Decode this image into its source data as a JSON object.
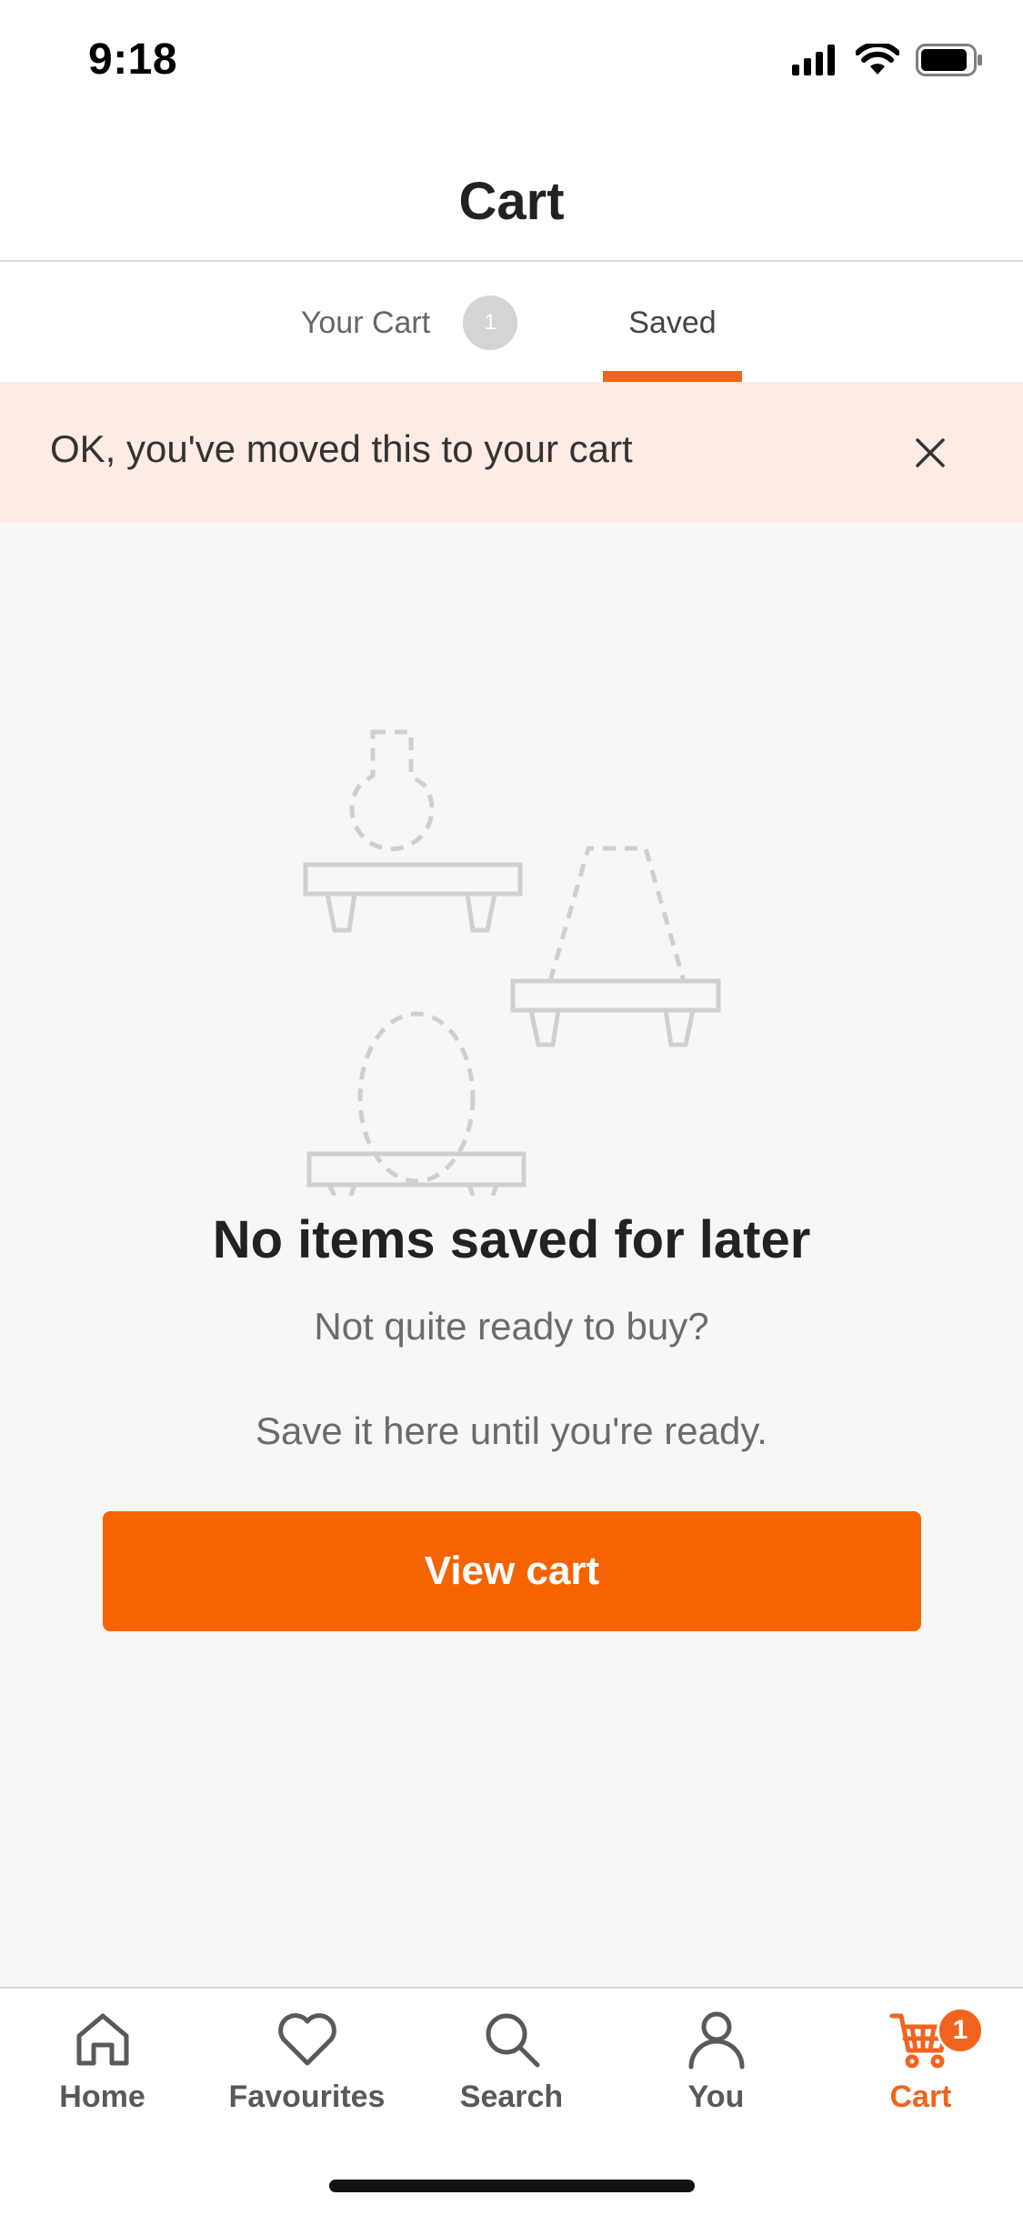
{
  "status_bar": {
    "time": "9:18"
  },
  "header": {
    "title": "Cart"
  },
  "tabs": {
    "your_cart": {
      "label": "Your Cart",
      "count": "1"
    },
    "saved": {
      "label": "Saved"
    }
  },
  "banner": {
    "message": "OK, you've moved this to your cart"
  },
  "empty_state": {
    "title": "No items saved for later",
    "subtitle_line1": "Not quite ready to buy?",
    "subtitle_line2": "Save it here until you're ready.",
    "button_label": "View cart"
  },
  "bottom_nav": {
    "items": [
      {
        "label": "Home",
        "icon": "home-icon"
      },
      {
        "label": "Favourites",
        "icon": "heart-icon"
      },
      {
        "label": "Search",
        "icon": "search-icon"
      },
      {
        "label": "You",
        "icon": "person-icon"
      },
      {
        "label": "Cart",
        "icon": "cart-icon",
        "badge": "1",
        "active": true
      }
    ]
  },
  "colors": {
    "accent": "#f1641e",
    "button": "#f56400",
    "banner_bg": "#fdebe4",
    "content_bg": "#f8f7f5"
  }
}
